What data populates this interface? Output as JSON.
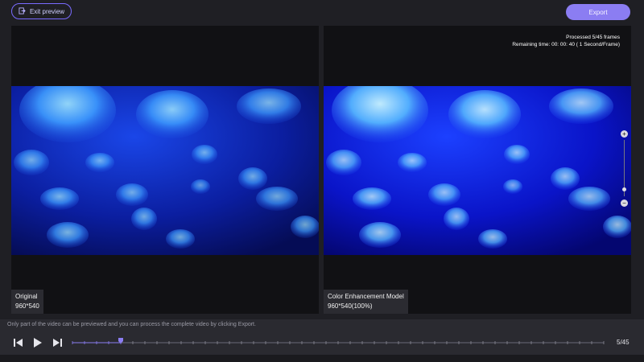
{
  "header": {
    "exit_label": "Exit preview",
    "export_label": "Export"
  },
  "left_panel": {
    "title": "Original",
    "resolution": "960*540"
  },
  "right_panel": {
    "title": "Color Enhancement Model",
    "resolution": "960*540(100%)",
    "processed_text": "Processed 5/45 frames",
    "remaining_text": "Remaining time: 00: 00: 40 ( 1 Second/Frame)"
  },
  "zoom": {
    "plus_symbol": "+",
    "minus_symbol": "−",
    "level_fraction": 0.1
  },
  "footer": {
    "hint": "Only part of the video can be previewed and you can process the complete video by clicking Export.",
    "frame_count": "5/45",
    "current_frame": 5,
    "total_frames": 45
  },
  "colors": {
    "accent": "#8b7df2",
    "background": "#1f1f24",
    "panel": "#111114"
  },
  "icons": [
    "exit-icon",
    "prev-frame-icon",
    "play-icon",
    "next-frame-icon",
    "zoom-in-icon",
    "zoom-out-icon"
  ]
}
